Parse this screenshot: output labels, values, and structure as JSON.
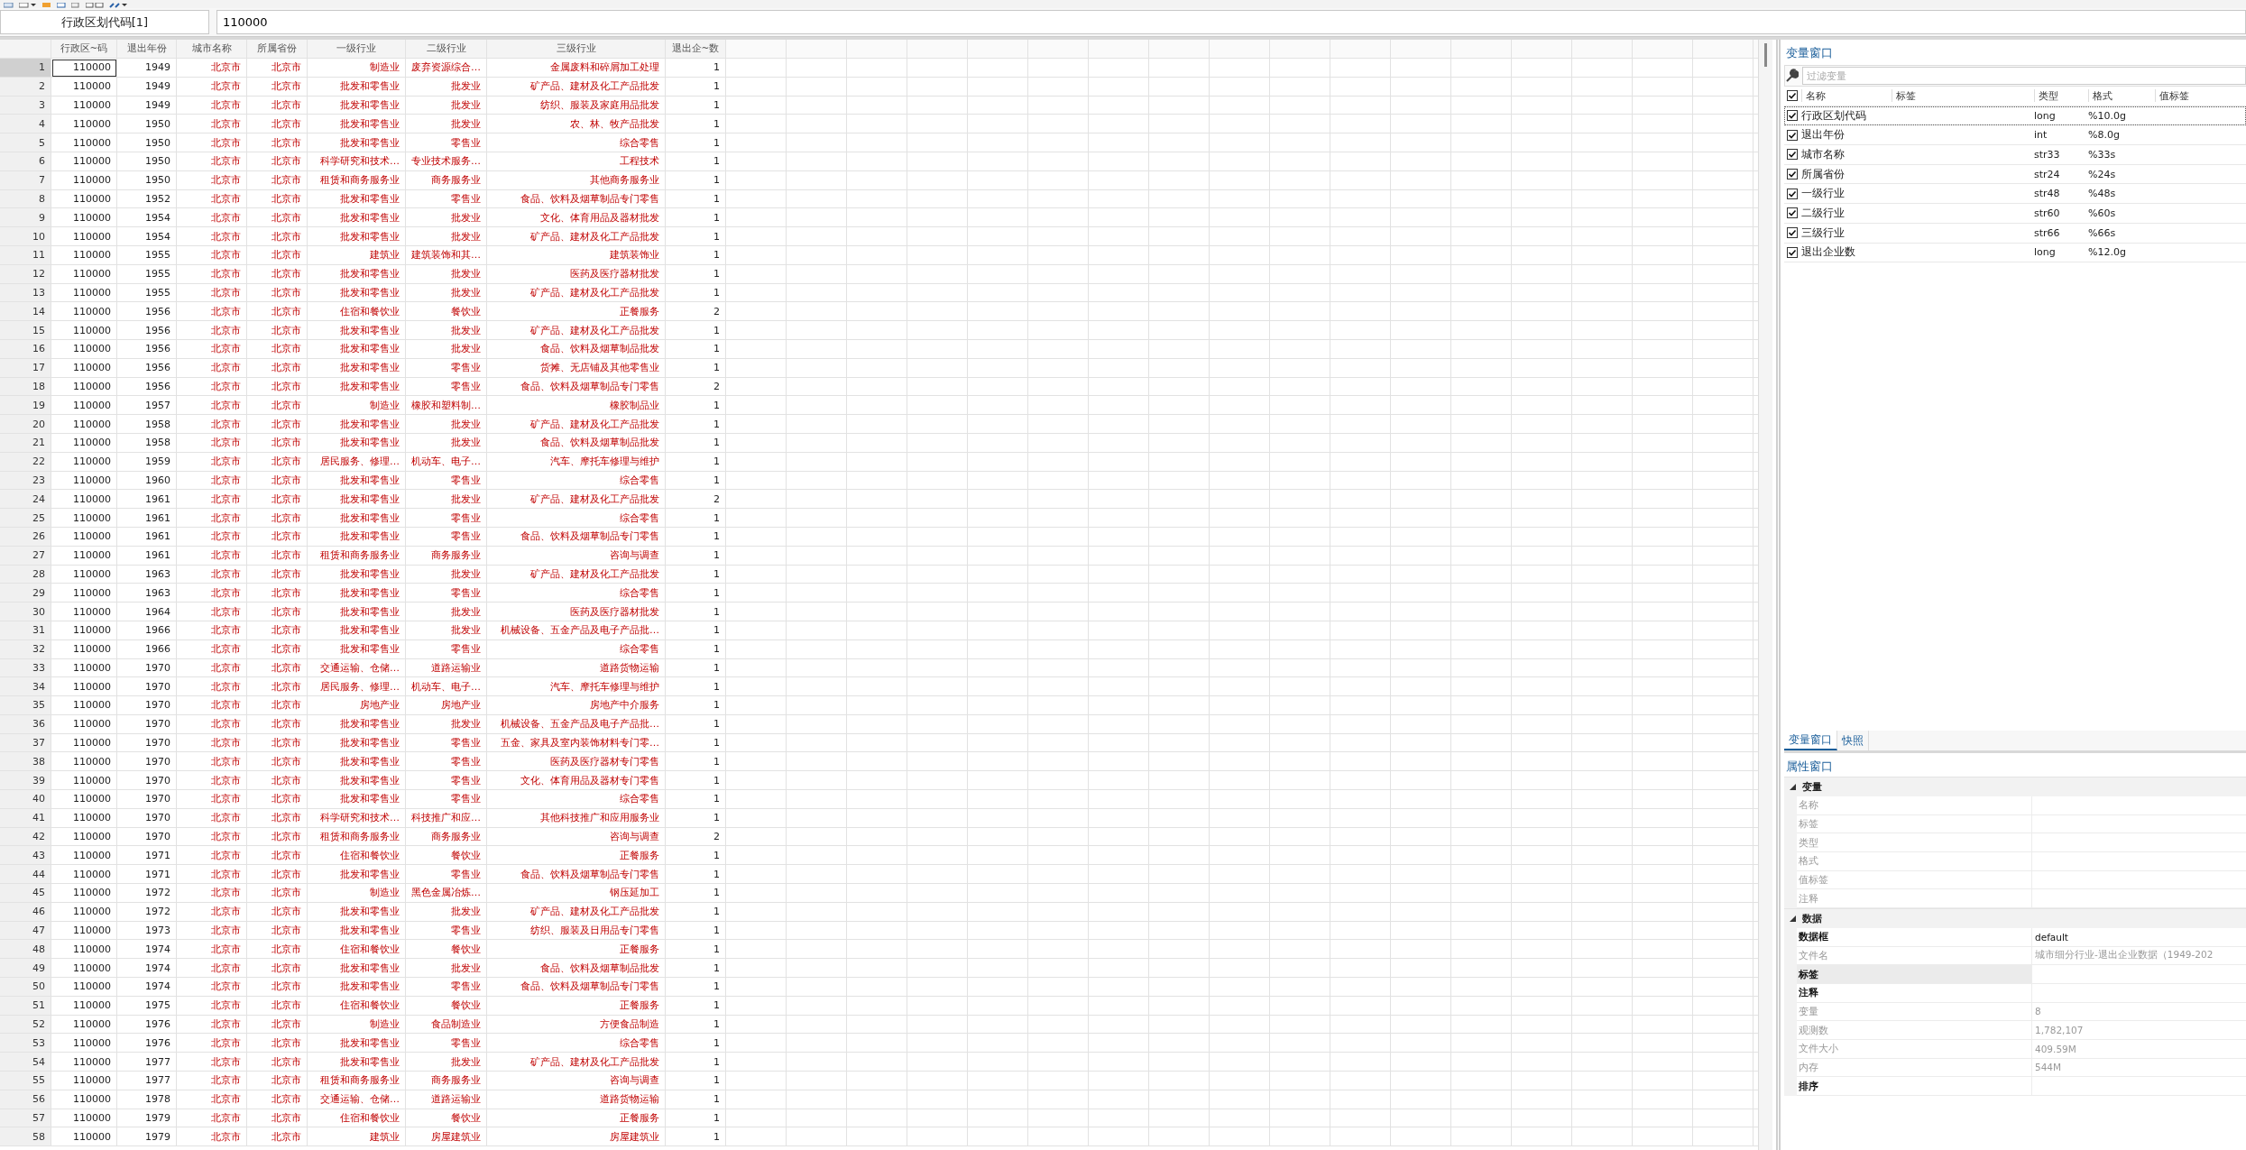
{
  "cell_bar": {
    "reference": "行政区划代码[1]",
    "value": "110000"
  },
  "grid": {
    "columns": [
      {
        "label": "行政区~码",
        "kind": "numeric"
      },
      {
        "label": "退出年份",
        "kind": "numeric"
      },
      {
        "label": "城市名称",
        "kind": "string"
      },
      {
        "label": "所属省份",
        "kind": "string"
      },
      {
        "label": "一级行业",
        "kind": "string"
      },
      {
        "label": "二级行业",
        "kind": "string"
      },
      {
        "label": "三级行业",
        "kind": "string"
      },
      {
        "label": "退出企~数",
        "kind": "numeric"
      }
    ],
    "rows": [
      {
        "number": "1",
        "selected": true,
        "cells": [
          "110000",
          "1949",
          "北京市",
          "北京市",
          "制造业",
          "废弃资源综合…",
          "金属废料和碎屑加工处理",
          "1"
        ]
      },
      {
        "number": "2",
        "selected": false,
        "cells": [
          "110000",
          "1949",
          "北京市",
          "北京市",
          "批发和零售业",
          "批发业",
          "矿产品、建材及化工产品批发",
          "1"
        ]
      },
      {
        "number": "3",
        "selected": false,
        "cells": [
          "110000",
          "1949",
          "北京市",
          "北京市",
          "批发和零售业",
          "批发业",
          "纺织、服装及家庭用品批发",
          "1"
        ]
      },
      {
        "number": "4",
        "selected": false,
        "cells": [
          "110000",
          "1950",
          "北京市",
          "北京市",
          "批发和零售业",
          "批发业",
          "农、林、牧产品批发",
          "1"
        ]
      },
      {
        "number": "5",
        "selected": false,
        "cells": [
          "110000",
          "1950",
          "北京市",
          "北京市",
          "批发和零售业",
          "零售业",
          "综合零售",
          "1"
        ]
      },
      {
        "number": "6",
        "selected": false,
        "cells": [
          "110000",
          "1950",
          "北京市",
          "北京市",
          "科学研究和技术…",
          "专业技术服务…",
          "工程技术",
          "1"
        ]
      },
      {
        "number": "7",
        "selected": false,
        "cells": [
          "110000",
          "1950",
          "北京市",
          "北京市",
          "租赁和商务服务业",
          "商务服务业",
          "其他商务服务业",
          "1"
        ]
      },
      {
        "number": "8",
        "selected": false,
        "cells": [
          "110000",
          "1952",
          "北京市",
          "北京市",
          "批发和零售业",
          "零售业",
          "食品、饮料及烟草制品专门零售",
          "1"
        ]
      },
      {
        "number": "9",
        "selected": false,
        "cells": [
          "110000",
          "1954",
          "北京市",
          "北京市",
          "批发和零售业",
          "批发业",
          "文化、体育用品及器材批发",
          "1"
        ]
      },
      {
        "number": "10",
        "selected": false,
        "cells": [
          "110000",
          "1954",
          "北京市",
          "北京市",
          "批发和零售业",
          "批发业",
          "矿产品、建材及化工产品批发",
          "1"
        ]
      },
      {
        "number": "11",
        "selected": false,
        "cells": [
          "110000",
          "1955",
          "北京市",
          "北京市",
          "建筑业",
          "建筑装饰和其…",
          "建筑装饰业",
          "1"
        ]
      },
      {
        "number": "12",
        "selected": false,
        "cells": [
          "110000",
          "1955",
          "北京市",
          "北京市",
          "批发和零售业",
          "批发业",
          "医药及医疗器材批发",
          "1"
        ]
      },
      {
        "number": "13",
        "selected": false,
        "cells": [
          "110000",
          "1955",
          "北京市",
          "北京市",
          "批发和零售业",
          "批发业",
          "矿产品、建材及化工产品批发",
          "1"
        ]
      },
      {
        "number": "14",
        "selected": false,
        "cells": [
          "110000",
          "1956",
          "北京市",
          "北京市",
          "住宿和餐饮业",
          "餐饮业",
          "正餐服务",
          "2"
        ]
      },
      {
        "number": "15",
        "selected": false,
        "cells": [
          "110000",
          "1956",
          "北京市",
          "北京市",
          "批发和零售业",
          "批发业",
          "矿产品、建材及化工产品批发",
          "1"
        ]
      },
      {
        "number": "16",
        "selected": false,
        "cells": [
          "110000",
          "1956",
          "北京市",
          "北京市",
          "批发和零售业",
          "批发业",
          "食品、饮料及烟草制品批发",
          "1"
        ]
      },
      {
        "number": "17",
        "selected": false,
        "cells": [
          "110000",
          "1956",
          "北京市",
          "北京市",
          "批发和零售业",
          "零售业",
          "货摊、无店铺及其他零售业",
          "1"
        ]
      },
      {
        "number": "18",
        "selected": false,
        "cells": [
          "110000",
          "1956",
          "北京市",
          "北京市",
          "批发和零售业",
          "零售业",
          "食品、饮料及烟草制品专门零售",
          "2"
        ]
      },
      {
        "number": "19",
        "selected": false,
        "cells": [
          "110000",
          "1957",
          "北京市",
          "北京市",
          "制造业",
          "橡胶和塑料制…",
          "橡胶制品业",
          "1"
        ]
      },
      {
        "number": "20",
        "selected": false,
        "cells": [
          "110000",
          "1958",
          "北京市",
          "北京市",
          "批发和零售业",
          "批发业",
          "矿产品、建材及化工产品批发",
          "1"
        ]
      },
      {
        "number": "21",
        "selected": false,
        "cells": [
          "110000",
          "1958",
          "北京市",
          "北京市",
          "批发和零售业",
          "批发业",
          "食品、饮料及烟草制品批发",
          "1"
        ]
      },
      {
        "number": "22",
        "selected": false,
        "cells": [
          "110000",
          "1959",
          "北京市",
          "北京市",
          "居民服务、修理…",
          "机动车、电子…",
          "汽车、摩托车修理与维护",
          "1"
        ]
      },
      {
        "number": "23",
        "selected": false,
        "cells": [
          "110000",
          "1960",
          "北京市",
          "北京市",
          "批发和零售业",
          "零售业",
          "综合零售",
          "1"
        ]
      },
      {
        "number": "24",
        "selected": false,
        "cells": [
          "110000",
          "1961",
          "北京市",
          "北京市",
          "批发和零售业",
          "批发业",
          "矿产品、建材及化工产品批发",
          "2"
        ]
      },
      {
        "number": "25",
        "selected": false,
        "cells": [
          "110000",
          "1961",
          "北京市",
          "北京市",
          "批发和零售业",
          "零售业",
          "综合零售",
          "1"
        ]
      },
      {
        "number": "26",
        "selected": false,
        "cells": [
          "110000",
          "1961",
          "北京市",
          "北京市",
          "批发和零售业",
          "零售业",
          "食品、饮料及烟草制品专门零售",
          "1"
        ]
      },
      {
        "number": "27",
        "selected": false,
        "cells": [
          "110000",
          "1961",
          "北京市",
          "北京市",
          "租赁和商务服务业",
          "商务服务业",
          "咨询与调查",
          "1"
        ]
      },
      {
        "number": "28",
        "selected": false,
        "cells": [
          "110000",
          "1963",
          "北京市",
          "北京市",
          "批发和零售业",
          "批发业",
          "矿产品、建材及化工产品批发",
          "1"
        ]
      },
      {
        "number": "29",
        "selected": false,
        "cells": [
          "110000",
          "1963",
          "北京市",
          "北京市",
          "批发和零售业",
          "零售业",
          "综合零售",
          "1"
        ]
      },
      {
        "number": "30",
        "selected": false,
        "cells": [
          "110000",
          "1964",
          "北京市",
          "北京市",
          "批发和零售业",
          "批发业",
          "医药及医疗器材批发",
          "1"
        ]
      },
      {
        "number": "31",
        "selected": false,
        "cells": [
          "110000",
          "1966",
          "北京市",
          "北京市",
          "批发和零售业",
          "批发业",
          "机械设备、五金产品及电子产品批…",
          "1"
        ]
      },
      {
        "number": "32",
        "selected": false,
        "cells": [
          "110000",
          "1966",
          "北京市",
          "北京市",
          "批发和零售业",
          "零售业",
          "综合零售",
          "1"
        ]
      },
      {
        "number": "33",
        "selected": false,
        "cells": [
          "110000",
          "1970",
          "北京市",
          "北京市",
          "交通运输、仓储…",
          "道路运输业",
          "道路货物运输",
          "1"
        ]
      },
      {
        "number": "34",
        "selected": false,
        "cells": [
          "110000",
          "1970",
          "北京市",
          "北京市",
          "居民服务、修理…",
          "机动车、电子…",
          "汽车、摩托车修理与维护",
          "1"
        ]
      },
      {
        "number": "35",
        "selected": false,
        "cells": [
          "110000",
          "1970",
          "北京市",
          "北京市",
          "房地产业",
          "房地产业",
          "房地产中介服务",
          "1"
        ]
      },
      {
        "number": "36",
        "selected": false,
        "cells": [
          "110000",
          "1970",
          "北京市",
          "北京市",
          "批发和零售业",
          "批发业",
          "机械设备、五金产品及电子产品批…",
          "1"
        ]
      },
      {
        "number": "37",
        "selected": false,
        "cells": [
          "110000",
          "1970",
          "北京市",
          "北京市",
          "批发和零售业",
          "零售业",
          "五金、家具及室内装饰材料专门零…",
          "1"
        ]
      },
      {
        "number": "38",
        "selected": false,
        "cells": [
          "110000",
          "1970",
          "北京市",
          "北京市",
          "批发和零售业",
          "零售业",
          "医药及医疗器材专门零售",
          "1"
        ]
      },
      {
        "number": "39",
        "selected": false,
        "cells": [
          "110000",
          "1970",
          "北京市",
          "北京市",
          "批发和零售业",
          "零售业",
          "文化、体育用品及器材专门零售",
          "1"
        ]
      },
      {
        "number": "40",
        "selected": false,
        "cells": [
          "110000",
          "1970",
          "北京市",
          "北京市",
          "批发和零售业",
          "零售业",
          "综合零售",
          "1"
        ]
      },
      {
        "number": "41",
        "selected": false,
        "cells": [
          "110000",
          "1970",
          "北京市",
          "北京市",
          "科学研究和技术…",
          "科技推广和应…",
          "其他科技推广和应用服务业",
          "1"
        ]
      },
      {
        "number": "42",
        "selected": false,
        "cells": [
          "110000",
          "1970",
          "北京市",
          "北京市",
          "租赁和商务服务业",
          "商务服务业",
          "咨询与调查",
          "2"
        ]
      },
      {
        "number": "43",
        "selected": false,
        "cells": [
          "110000",
          "1971",
          "北京市",
          "北京市",
          "住宿和餐饮业",
          "餐饮业",
          "正餐服务",
          "1"
        ]
      },
      {
        "number": "44",
        "selected": false,
        "cells": [
          "110000",
          "1971",
          "北京市",
          "北京市",
          "批发和零售业",
          "零售业",
          "食品、饮料及烟草制品专门零售",
          "1"
        ]
      },
      {
        "number": "45",
        "selected": false,
        "cells": [
          "110000",
          "1972",
          "北京市",
          "北京市",
          "制造业",
          "黑色金属冶炼…",
          "钢压延加工",
          "1"
        ]
      },
      {
        "number": "46",
        "selected": false,
        "cells": [
          "110000",
          "1972",
          "北京市",
          "北京市",
          "批发和零售业",
          "批发业",
          "矿产品、建材及化工产品批发",
          "1"
        ]
      },
      {
        "number": "47",
        "selected": false,
        "cells": [
          "110000",
          "1973",
          "北京市",
          "北京市",
          "批发和零售业",
          "零售业",
          "纺织、服装及日用品专门零售",
          "1"
        ]
      },
      {
        "number": "48",
        "selected": false,
        "cells": [
          "110000",
          "1974",
          "北京市",
          "北京市",
          "住宿和餐饮业",
          "餐饮业",
          "正餐服务",
          "1"
        ]
      },
      {
        "number": "49",
        "selected": false,
        "cells": [
          "110000",
          "1974",
          "北京市",
          "北京市",
          "批发和零售业",
          "批发业",
          "食品、饮料及烟草制品批发",
          "1"
        ]
      },
      {
        "number": "50",
        "selected": false,
        "cells": [
          "110000",
          "1974",
          "北京市",
          "北京市",
          "批发和零售业",
          "零售业",
          "食品、饮料及烟草制品专门零售",
          "1"
        ]
      },
      {
        "number": "51",
        "selected": false,
        "cells": [
          "110000",
          "1975",
          "北京市",
          "北京市",
          "住宿和餐饮业",
          "餐饮业",
          "正餐服务",
          "1"
        ]
      },
      {
        "number": "52",
        "selected": false,
        "cells": [
          "110000",
          "1976",
          "北京市",
          "北京市",
          "制造业",
          "食品制造业",
          "方便食品制造",
          "1"
        ]
      },
      {
        "number": "53",
        "selected": false,
        "cells": [
          "110000",
          "1976",
          "北京市",
          "北京市",
          "批发和零售业",
          "零售业",
          "综合零售",
          "1"
        ]
      },
      {
        "number": "54",
        "selected": false,
        "cells": [
          "110000",
          "1977",
          "北京市",
          "北京市",
          "批发和零售业",
          "批发业",
          "矿产品、建材及化工产品批发",
          "1"
        ]
      },
      {
        "number": "55",
        "selected": false,
        "cells": [
          "110000",
          "1977",
          "北京市",
          "北京市",
          "租赁和商务服务业",
          "商务服务业",
          "咨询与调查",
          "1"
        ]
      },
      {
        "number": "56",
        "selected": false,
        "cells": [
          "110000",
          "1978",
          "北京市",
          "北京市",
          "交通运输、仓储…",
          "道路运输业",
          "道路货物运输",
          "1"
        ]
      },
      {
        "number": "57",
        "selected": false,
        "cells": [
          "110000",
          "1979",
          "北京市",
          "北京市",
          "住宿和餐饮业",
          "餐饮业",
          "正餐服务",
          "1"
        ]
      },
      {
        "number": "58",
        "selected": false,
        "cells": [
          "110000",
          "1979",
          "北京市",
          "北京市",
          "建筑业",
          "房屋建筑业",
          "房屋建筑业",
          "1"
        ]
      }
    ]
  },
  "variable_window": {
    "title": "变量窗口",
    "filter_placeholder": "过滤变量",
    "all_checked": true,
    "columns": [
      "名称",
      "标签",
      "类型",
      "格式",
      "值标签"
    ],
    "variables": [
      {
        "name": "行政区划代码",
        "type": "long",
        "format": "%10.0g",
        "checked": true,
        "selected": true
      },
      {
        "name": "退出年份",
        "type": "int",
        "format": "%8.0g",
        "checked": true,
        "selected": false
      },
      {
        "name": "城市名称",
        "type": "str33",
        "format": "%33s",
        "checked": true,
        "selected": false
      },
      {
        "name": "所属省份",
        "type": "str24",
        "format": "%24s",
        "checked": true,
        "selected": false
      },
      {
        "name": "一级行业",
        "type": "str48",
        "format": "%48s",
        "checked": true,
        "selected": false
      },
      {
        "name": "二级行业",
        "type": "str60",
        "format": "%60s",
        "checked": true,
        "selected": false
      },
      {
        "name": "三级行业",
        "type": "str66",
        "format": "%66s",
        "checked": true,
        "selected": false
      },
      {
        "name": "退出企业数",
        "type": "long",
        "format": "%12.0g",
        "checked": true,
        "selected": false
      }
    ]
  },
  "panel_tabs": [
    {
      "label": "变量窗口",
      "selected": true
    },
    {
      "label": "快照",
      "selected": false
    }
  ],
  "properties": {
    "title": "属性窗口",
    "sections": [
      {
        "label": "变量",
        "expanded": true,
        "rows": [
          {
            "label": "名称",
            "disabled": true,
            "selected": false
          },
          {
            "label": "标签",
            "disabled": true,
            "selected": false
          },
          {
            "label": "类型",
            "disabled": true,
            "selected": false
          },
          {
            "label": "格式",
            "disabled": true,
            "selected": false
          },
          {
            "label": "值标签",
            "disabled": true,
            "selected": false
          },
          {
            "label": "注释",
            "disabled": true,
            "selected": false
          }
        ]
      },
      {
        "label": "数据",
        "expanded": true,
        "rows": [
          {
            "label": "数据框",
            "value": "default",
            "disabled": false,
            "selected": false
          },
          {
            "label": "文件名",
            "value": "城市细分行业-退出企业数据（1949-202",
            "disabled": true,
            "selected": false
          },
          {
            "label": "标签",
            "disabled": false,
            "selected": true
          },
          {
            "label": "注释",
            "disabled": false,
            "selected": false
          },
          {
            "label": "变量",
            "value": "8",
            "disabled": true,
            "selected": false
          },
          {
            "label": "观测数",
            "value": "1,782,107",
            "disabled": true,
            "selected": false
          },
          {
            "label": "文件大小",
            "value": "409.59M",
            "disabled": true,
            "selected": false
          },
          {
            "label": "内存",
            "value": "544M",
            "disabled": true,
            "selected": false
          },
          {
            "label": "排序",
            "disabled": false,
            "selected": false
          }
        ]
      }
    ]
  }
}
